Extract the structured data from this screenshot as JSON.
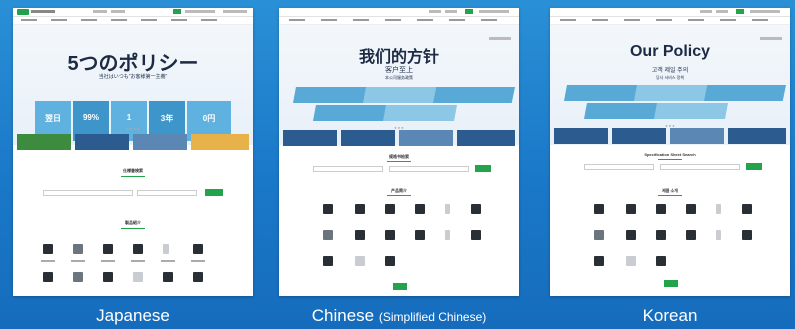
{
  "panels": [
    {
      "id": "japanese",
      "hero_title": "5つのポリシー",
      "hero_subtitle": "当社はいつも\"お客様第一主義\"",
      "tiles": [
        {
          "label": "翌日",
          "value": "翌日"
        },
        {
          "label": "",
          "value": "99%"
        },
        {
          "label": "",
          "value": "1"
        },
        {
          "label": "",
          "value": "3年"
        },
        {
          "label": "",
          "value": "0円"
        }
      ],
      "section1_title": "仕様書検索",
      "section2_title": "製品紹介",
      "caption": "Japanese",
      "caption_note": ""
    },
    {
      "id": "chinese",
      "hero_title": "我们的方针",
      "hero_subtitle": "客户至上",
      "hero_subtitle2": "本公司服务政策",
      "section1_title": "规格书检索",
      "section2_title": "产品简介",
      "caption": "Chinese",
      "caption_note": "(Simplified Chinese)"
    },
    {
      "id": "korean",
      "hero_title": "Our Policy",
      "hero_subtitle": "고객 제일 주의",
      "hero_subtitle2": "당사 서비스 정책",
      "section1_title": "Specification Sheet Search",
      "section2_title": "제품 소개",
      "caption": "Korean",
      "caption_note": ""
    }
  ]
}
